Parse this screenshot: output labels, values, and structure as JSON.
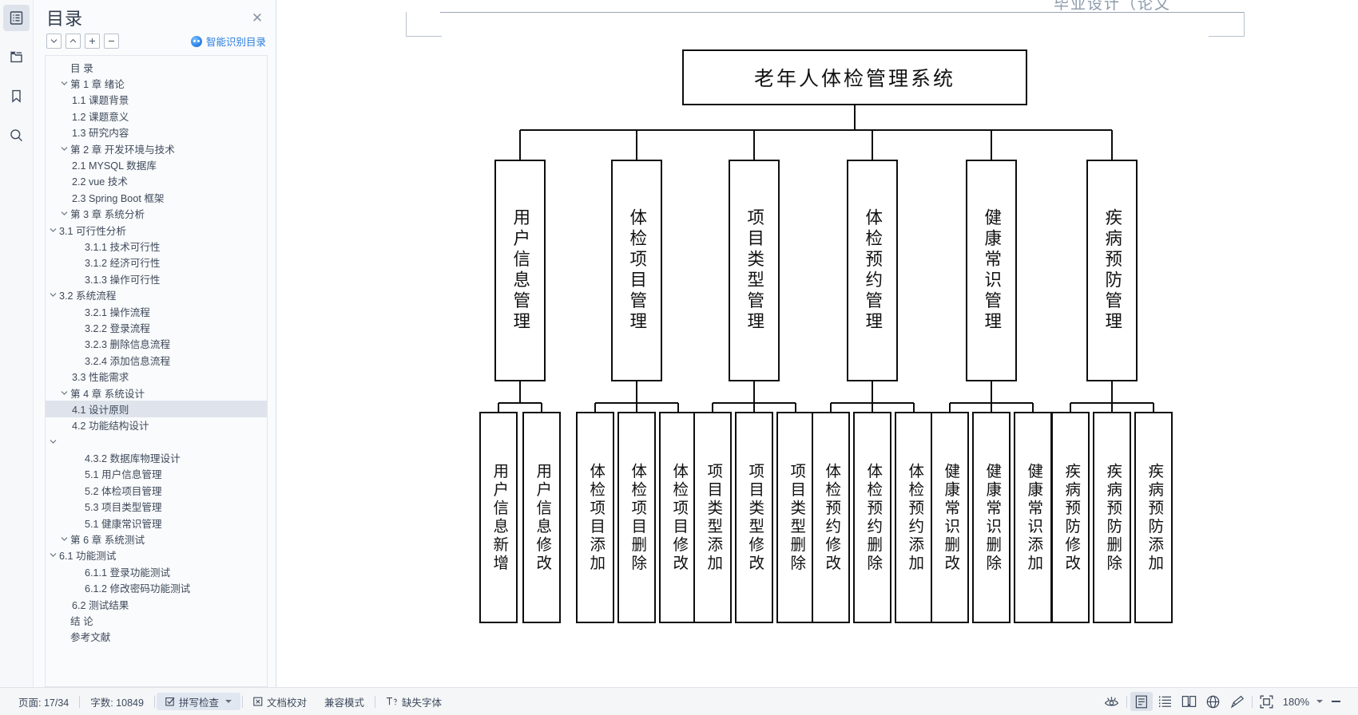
{
  "rail": {
    "items": [
      {
        "name": "outline-icon",
        "active": true
      },
      {
        "name": "attachment-icon",
        "active": false
      },
      {
        "name": "bookmark-icon",
        "active": false
      },
      {
        "name": "search-icon",
        "active": false
      }
    ]
  },
  "outline": {
    "title": "目录",
    "close_label": "✕",
    "tools": [
      {
        "name": "expand-all-button",
        "glyph": "⌄"
      },
      {
        "name": "collapse-all-button",
        "glyph": "⌃"
      },
      {
        "name": "increase-level-button",
        "glyph": "+"
      },
      {
        "name": "decrease-level-button",
        "glyph": "−"
      }
    ],
    "smart_toc_label": "智能识别目录",
    "accent_color": "#2b7fe0",
    "selected_index": 21,
    "items": [
      {
        "label": "目  录",
        "level": 1,
        "chevron": "none"
      },
      {
        "label": "第 1 章 绪论",
        "level": 1,
        "chevron": "down"
      },
      {
        "label": "1.1 课题背景",
        "level": 3,
        "chevron": "none"
      },
      {
        "label": "1.2 课题意义",
        "level": 3,
        "chevron": "none"
      },
      {
        "label": "1.3 研究内容",
        "level": 3,
        "chevron": "none"
      },
      {
        "label": "第 2 章 开发环境与技术",
        "level": 1,
        "chevron": "down"
      },
      {
        "label": "2.1 MYSQL 数据库",
        "level": 3,
        "chevron": "none"
      },
      {
        "label": "2.2 vue 技术",
        "level": 3,
        "chevron": "none"
      },
      {
        "label": "2.3 Spring Boot 框架",
        "level": 3,
        "chevron": "none"
      },
      {
        "label": "第 3 章 系统分析",
        "level": 1,
        "chevron": "down"
      },
      {
        "label": "3.1 可行性分析",
        "level": 2,
        "chevron": "down"
      },
      {
        "label": "3.1.1 技术可行性",
        "level": 4,
        "chevron": "none"
      },
      {
        "label": "3.1.2 经济可行性",
        "level": 4,
        "chevron": "none"
      },
      {
        "label": "3.1.3 操作可行性",
        "level": 4,
        "chevron": "none"
      },
      {
        "label": "3.2 系统流程",
        "level": 2,
        "chevron": "down"
      },
      {
        "label": "3.2.1 操作流程",
        "level": 4,
        "chevron": "none"
      },
      {
        "label": "3.2.2 登录流程",
        "level": 4,
        "chevron": "none"
      },
      {
        "label": "3.2.3 删除信息流程",
        "level": 4,
        "chevron": "none"
      },
      {
        "label": "3.2.4 添加信息流程",
        "level": 4,
        "chevron": "none"
      },
      {
        "label": "3.3 性能需求",
        "level": 3,
        "chevron": "none"
      },
      {
        "label": "第 4 章 系统设计",
        "level": 1,
        "chevron": "down"
      },
      {
        "label": "4.1 设计原则",
        "level": 3,
        "chevron": "none"
      },
      {
        "label": "4.2 功能结构设计",
        "level": 3,
        "chevron": "none"
      },
      {
        "label": "",
        "level": 2,
        "chevron": "down"
      },
      {
        "label": "4.3.2 数据库物理设计",
        "level": 4,
        "chevron": "none"
      },
      {
        "label": "5.1 用户信息管理",
        "level": 4,
        "chevron": "none"
      },
      {
        "label": "5.2 体检项目管理",
        "level": 4,
        "chevron": "none"
      },
      {
        "label": "5.3 项目类型管理",
        "level": 4,
        "chevron": "none"
      },
      {
        "label": "5.1 健康常识管理",
        "level": 4,
        "chevron": "none"
      },
      {
        "label": "第 6 章 系统测试",
        "level": 1,
        "chevron": "down"
      },
      {
        "label": "6.1 功能测试",
        "level": 2,
        "chevron": "down"
      },
      {
        "label": "6.1.1 登录功能测试",
        "level": 4,
        "chevron": "none"
      },
      {
        "label": "6.1.2 修改密码功能测试",
        "level": 4,
        "chevron": "none"
      },
      {
        "label": "6.2 测试结果",
        "level": 3,
        "chevron": "none"
      },
      {
        "label": "结  论",
        "level": 1,
        "chevron": "none"
      },
      {
        "label": "参考文献",
        "level": 1,
        "chevron": "none"
      }
    ]
  },
  "document": {
    "header_text": "毕业设计（论文",
    "diagram": {
      "type": "org-tree",
      "root": "老年人体检管理系统",
      "level2": [
        "用户信息管理",
        "体检项目管理",
        "项目类型管理",
        "体检预约管理",
        "健康常识管理",
        "疾病预防管理"
      ],
      "level3_groups": [
        [
          "用户信息新增",
          "用户信息修改"
        ],
        [
          "体检项目添加",
          "体检项目删除",
          "体检项目修改"
        ],
        [
          "项目类型添加",
          "项目类型修改",
          "项目类型删除"
        ],
        [
          "体检预约修改",
          "体检预约删除",
          "体检预约添加"
        ],
        [
          "健康常识删改",
          "健康常识删除",
          "健康常识添加"
        ],
        [
          "疾病预防修改",
          "疾病预防删除",
          "疾病预防添加"
        ]
      ]
    }
  },
  "statusbar": {
    "page_label": "页面: 17/34",
    "words_label": "字数: 10849",
    "spellcheck_label": "拼写检查",
    "proofread_label": "文档校对",
    "compat_label": "兼容模式",
    "missing_font_label": "缺失字体",
    "zoom_label": "180%",
    "view_icons": [
      {
        "name": "eye-icon",
        "active": false
      },
      {
        "name": "page-view-icon",
        "active": true
      },
      {
        "name": "outline-view-icon",
        "active": false
      },
      {
        "name": "book-view-icon",
        "active": false
      },
      {
        "name": "web-view-icon",
        "active": false
      },
      {
        "name": "pen-view-icon",
        "active": false
      },
      {
        "name": "fit-page-icon",
        "active": false
      }
    ]
  }
}
